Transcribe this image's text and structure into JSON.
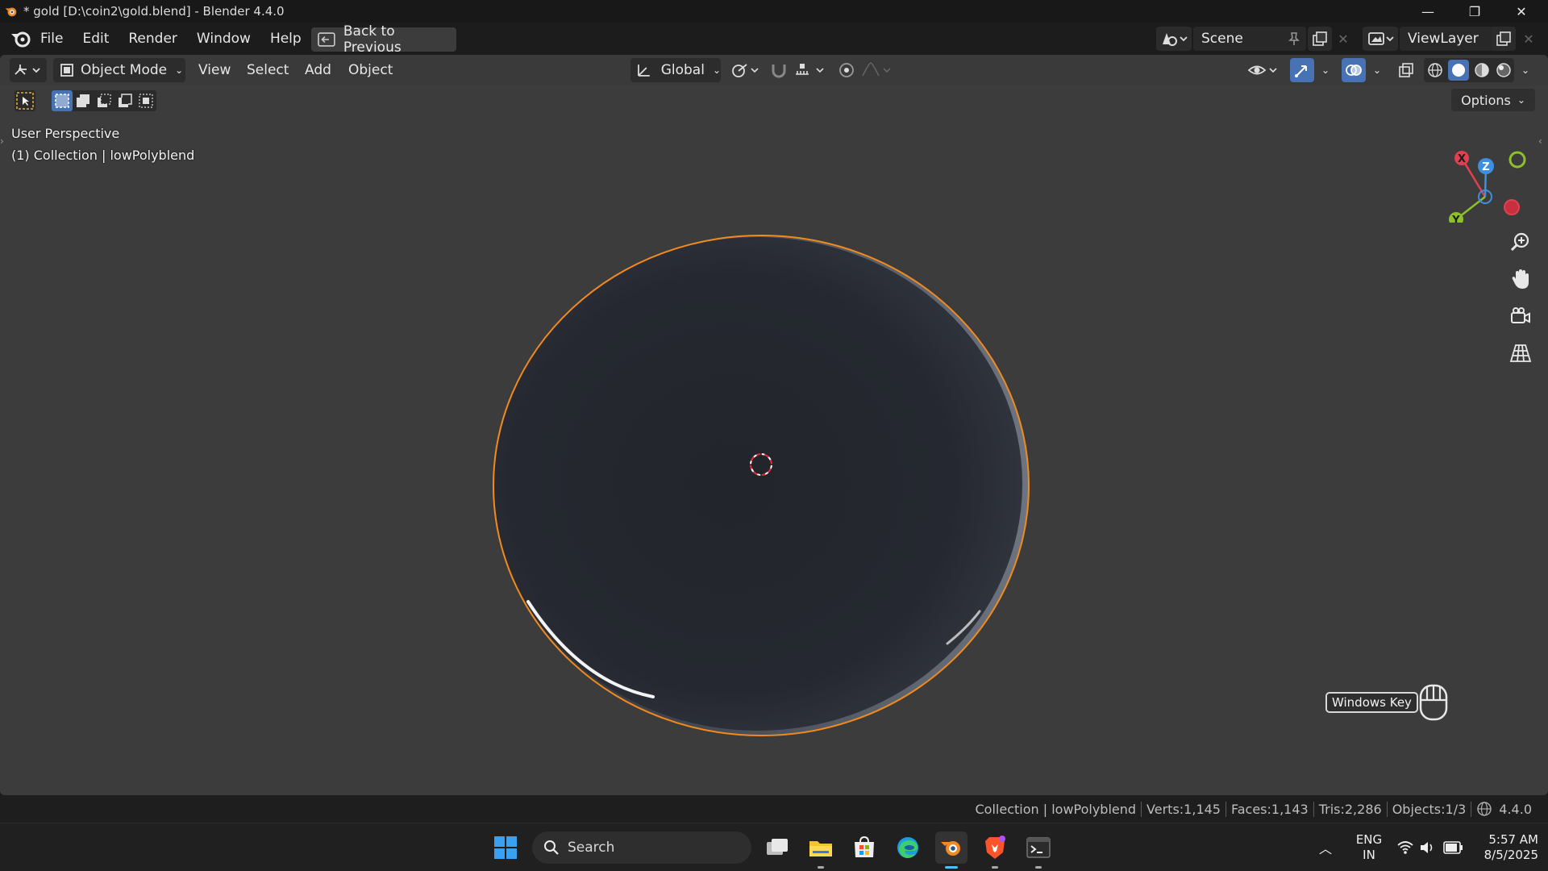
{
  "window": {
    "title": "* gold [D:\\coin2\\gold.blend] - Blender 4.4.0",
    "controls": {
      "minimize": "—",
      "maximize": "❐",
      "close": "✕"
    }
  },
  "menubar": {
    "items": [
      "File",
      "Edit",
      "Render",
      "Window",
      "Help"
    ],
    "back_button": "Back to Previous",
    "scene": "Scene",
    "view_layer": "ViewLayer"
  },
  "viewport_header": {
    "mode": "Object Mode",
    "menus": [
      "View",
      "Select",
      "Add",
      "Object"
    ],
    "transform_orientation": "Global",
    "options": "Options"
  },
  "viewport": {
    "perspective": "User Perspective",
    "collection_info": "(1) Collection | lowPolyblend",
    "gizmo_axes": {
      "x": "X",
      "y": "Y",
      "z": "Z"
    },
    "windows_key": "Windows Key"
  },
  "statusbar": {
    "items": [
      "Collection | lowPolyblend",
      "Verts:1,145",
      "Faces:1,143",
      "Tris:2,286",
      "Objects:1/3"
    ],
    "version": "4.4.0"
  },
  "taskbar": {
    "search_placeholder": "Search",
    "lang_line1": "ENG",
    "lang_line2": "IN",
    "time": "5:57 AM",
    "date": "8/5/2025"
  },
  "colors": {
    "selection_outline": "#f28a1e",
    "viewport_bg": "#3c3c3c",
    "axis_x": "#e04050",
    "axis_y": "#8fbf2a",
    "axis_z": "#3f8fe0"
  }
}
